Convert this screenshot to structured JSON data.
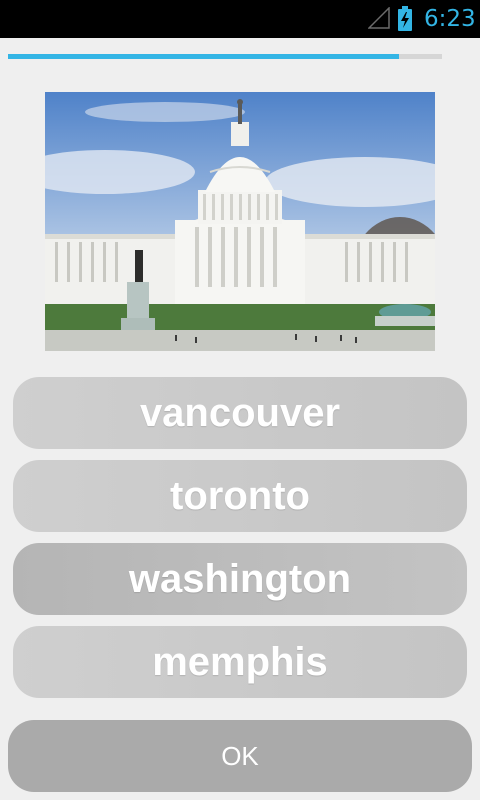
{
  "status_bar": {
    "time": "6:23",
    "battery_icon": "battery-charging-icon",
    "signal_icon": "signal-empty-icon"
  },
  "progress": {
    "value_fraction": 0.9,
    "color": "#33b5e5"
  },
  "quiz": {
    "image_subject": "capitol-building-photo",
    "answers": [
      {
        "label": "vancouver"
      },
      {
        "label": "toronto"
      },
      {
        "label": "washington"
      },
      {
        "label": "memphis"
      }
    ],
    "ok_label": "OK"
  }
}
